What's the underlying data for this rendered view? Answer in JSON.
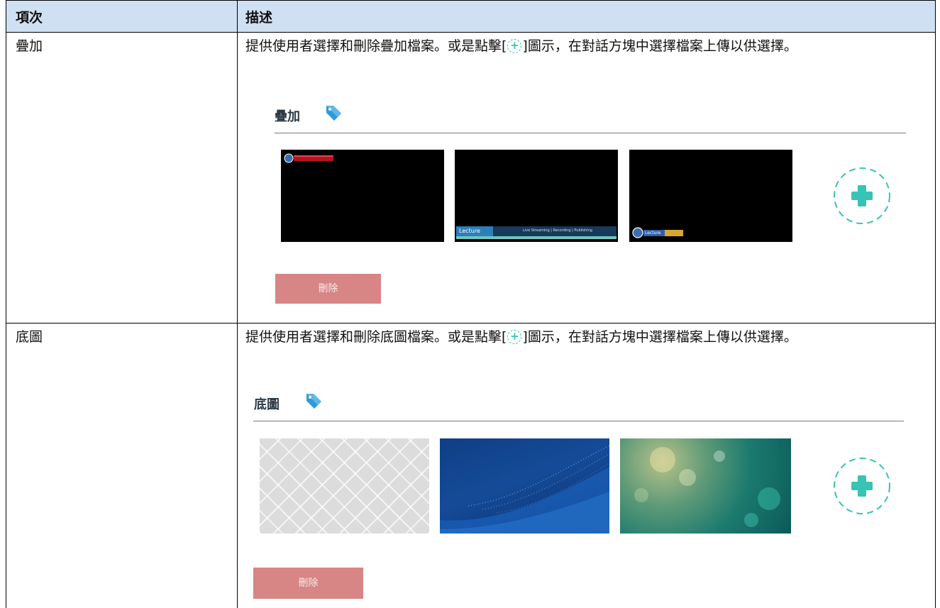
{
  "header": {
    "col_item": "項次",
    "col_desc": "描述"
  },
  "rows": [
    {
      "item": "疊加",
      "desc_before": "提供使用者選擇和刪除疊加檔案。或是點擊[",
      "desc_after": "]圖示，在對話方塊中選擇檔案上傳以供選擇。",
      "panel_title": "疊加",
      "delete_label": "刪除",
      "overlay_labels": {
        "lecture": "Lecture",
        "ticker": "Live Streaming | Recording | Publishing",
        "lecture_small": "Lecture"
      }
    },
    {
      "item": "底圖",
      "desc_before": "提供使用者選擇和刪除底圖檔案。或是點擊[",
      "desc_after": "]圖示，在對話方塊中選擇檔案上傳以供選擇。",
      "panel_title": "底圖",
      "delete_label": "刪除"
    }
  ],
  "icons": {
    "inline_add": "plus-circle-icon",
    "tag": "tag-icon",
    "add": "add-circle-icon"
  },
  "colors": {
    "header_bg": "#cfe0f2",
    "accent": "#37c3b6",
    "tag": "#2f9ad8",
    "delete_button": "#d78585"
  }
}
